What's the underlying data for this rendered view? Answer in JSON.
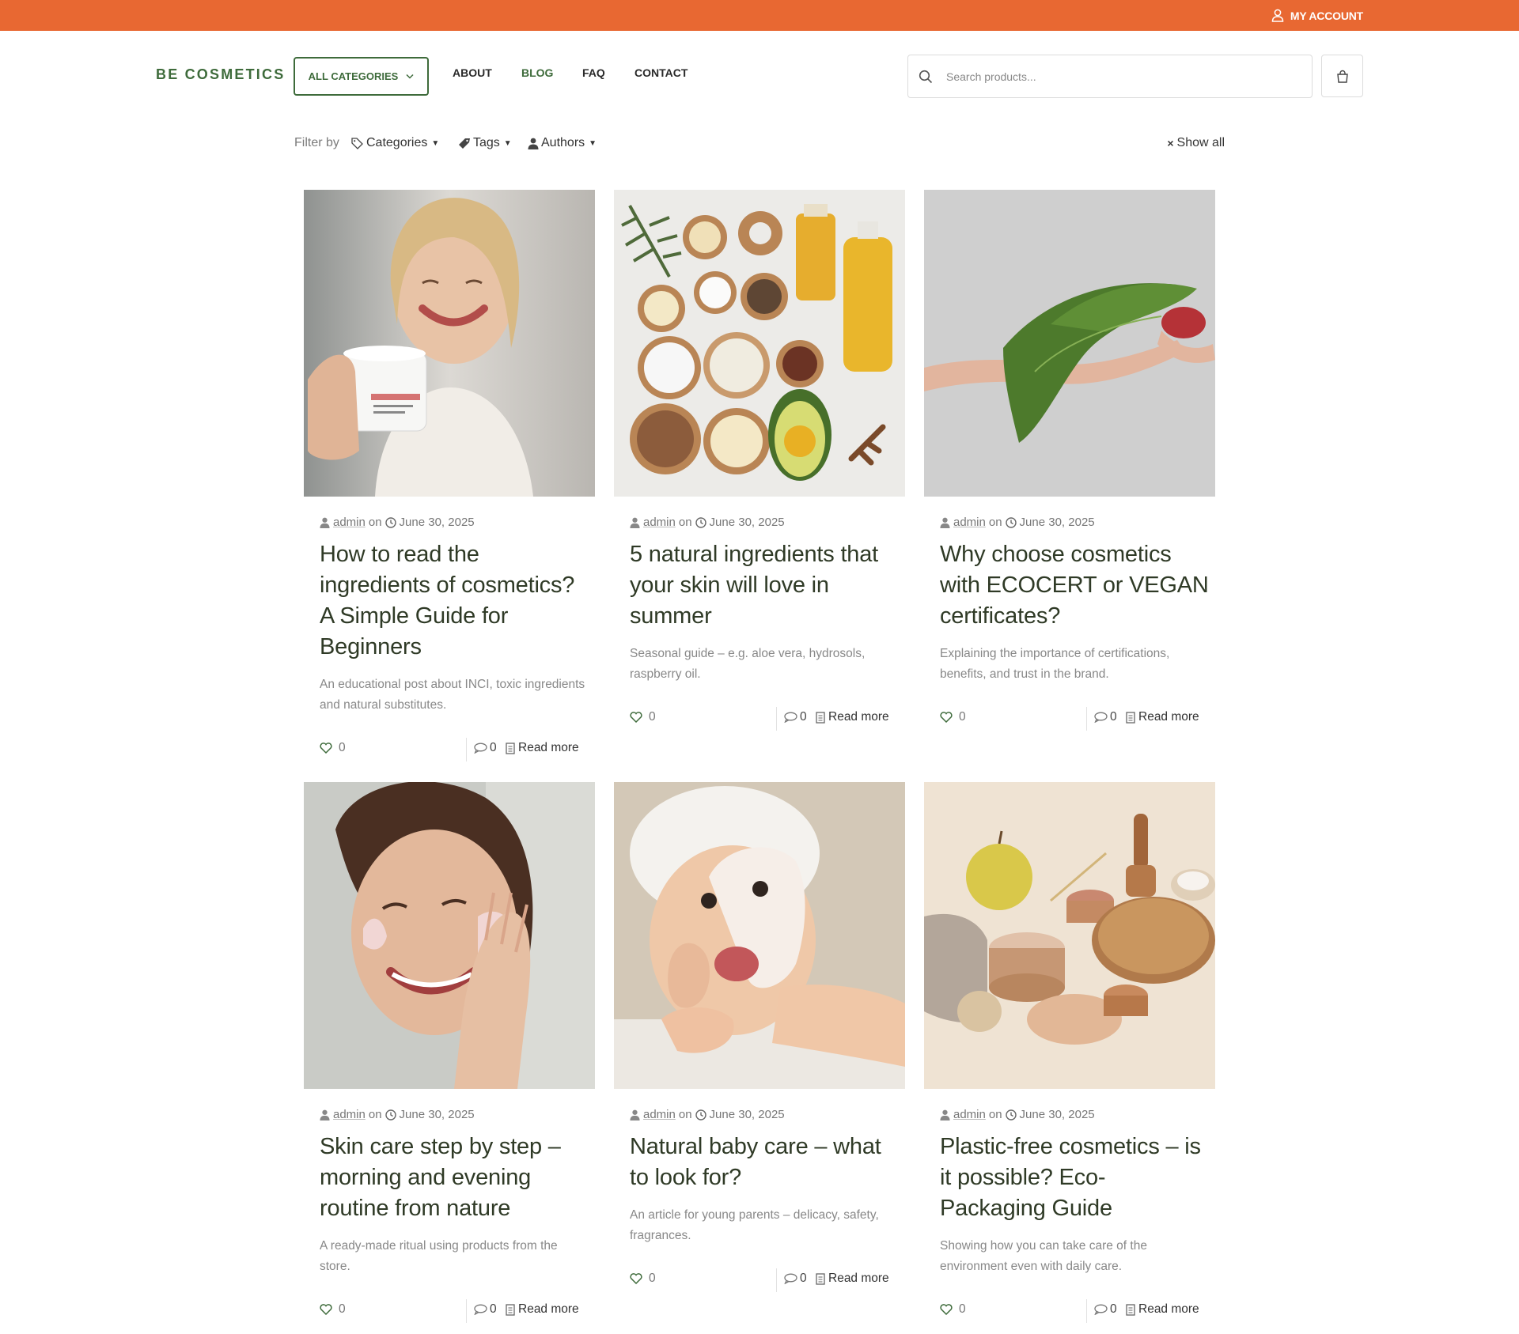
{
  "topbar": {
    "account_label": "MY ACCOUNT",
    "color": "#e86832"
  },
  "header": {
    "logo": "BE COSMETICS",
    "all_categories_label": "ALL CATEGORIES",
    "nav": [
      {
        "label": "ABOUT"
      },
      {
        "label": "BLOG"
      },
      {
        "label": "FAQ"
      },
      {
        "label": "CONTACT"
      }
    ],
    "search_placeholder": "Search products...",
    "accent": "#3e6b3b"
  },
  "filter": {
    "label": "Filter by",
    "categories": "Categories",
    "tags": "Tags",
    "authors": "Authors",
    "show_all": "Show all"
  },
  "posts": [
    {
      "author": "admin",
      "on": "on",
      "date": "June 30, 2025",
      "title": "How to read the ingredients of cosmetics? A Simple Guide for Beginners",
      "excerpt": "An educational post about INCI, toxic ingredients and natural substitutes.",
      "likes": "0",
      "comments": "0",
      "read_more": "Read more",
      "image": "woman-holding-cream-jar"
    },
    {
      "author": "admin",
      "on": "on",
      "date": "June 30, 2025",
      "title": "5 natural ingredients that your skin will love in summer",
      "excerpt": "Seasonal guide – e.g. aloe vera, hydrosols, raspberry oil.",
      "likes": "0",
      "comments": "0",
      "read_more": "Read more",
      "image": "natural-ingredients-flatlay"
    },
    {
      "author": "admin",
      "on": "on",
      "date": "June 30, 2025",
      "title": "Why choose cosmetics with ECOCERT or VEGAN certificates?",
      "excerpt": "Explaining the importance of certifications, benefits, and trust in the brand.",
      "likes": "0",
      "comments": "0",
      "read_more": "Read more",
      "image": "hand-with-green-leaf"
    },
    {
      "author": "admin",
      "on": "on",
      "date": "June 30, 2025",
      "title": "Skin care step by step – morning and evening routine from nature",
      "excerpt": "A ready-made ritual using products from the store.",
      "likes": "0",
      "comments": "0",
      "read_more": "Read more",
      "image": "woman-applying-face-cream"
    },
    {
      "author": "admin",
      "on": "on",
      "date": "June 30, 2025",
      "title": "Natural baby care – what to look for?",
      "excerpt": "An article for young parents – delicacy, safety, fragrances.",
      "likes": "0",
      "comments": "0",
      "read_more": "Read more",
      "image": "baby-with-cream"
    },
    {
      "author": "admin",
      "on": "on",
      "date": "June 30, 2025",
      "title": "Plastic-free cosmetics – is it possible? Eco-Packaging Guide",
      "excerpt": "Showing how you can take care of the environment even with daily care.",
      "likes": "0",
      "comments": "0",
      "read_more": "Read more",
      "image": "eco-packaging-jars"
    }
  ]
}
